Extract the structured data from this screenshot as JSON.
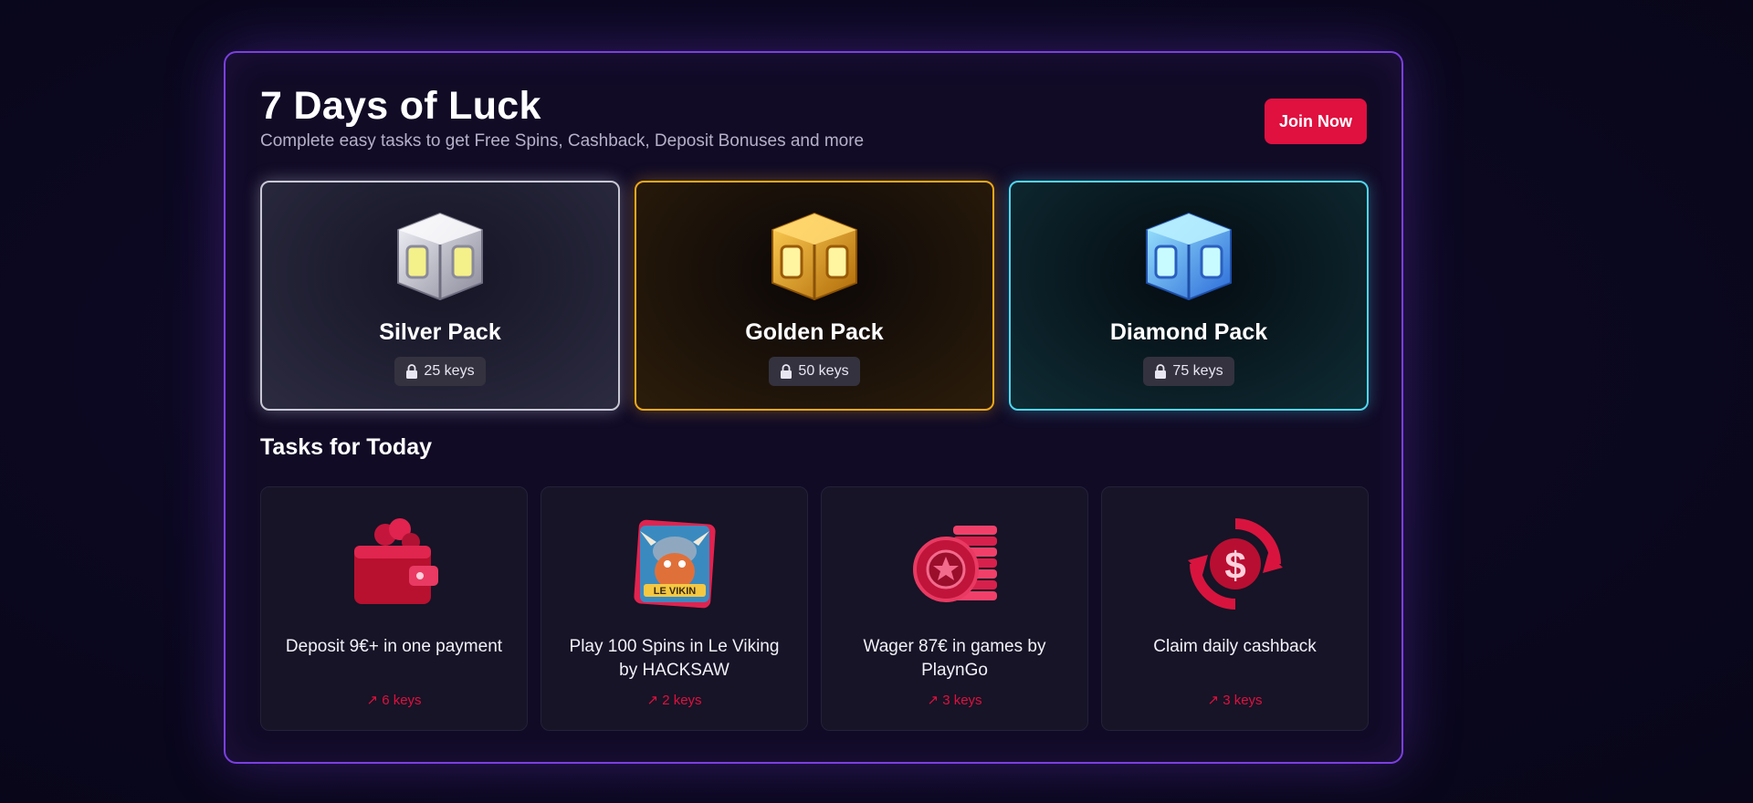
{
  "header": {
    "title": "7 Days of Luck",
    "subtitle": "Complete easy tasks to get Free Spins, Cashback, Deposit Bonuses and more",
    "join_label": "Join Now"
  },
  "colors": {
    "accent": "#e0103f",
    "panel_border": "#7b3fe0",
    "silver": "#c8c8d6",
    "gold": "#f0a818",
    "diamond": "#4fd6ee"
  },
  "packs": [
    {
      "name": "Silver Pack",
      "keys": "25 keys",
      "icon": "silver-cube-icon"
    },
    {
      "name": "Golden Pack",
      "keys": "50 keys",
      "icon": "gold-cube-icon"
    },
    {
      "name": "Diamond Pack",
      "keys": "75 keys",
      "icon": "diamond-cube-icon"
    }
  ],
  "tasks_title": "Tasks for Today",
  "tasks": [
    {
      "text": "Deposit 9€+ in one payment",
      "keys": "↗ 6 keys",
      "icon": "wallet-icon"
    },
    {
      "text": "Play 100 Spins in Le Viking by HACKSAW",
      "keys": "↗ 2 keys",
      "icon": "le-viking-game-icon"
    },
    {
      "text": "Wager 87€ in games by PlaynGo",
      "keys": "↗ 3 keys",
      "icon": "chip-stack-icon"
    },
    {
      "text": "Claim daily cashback",
      "keys": "↗ 3 keys",
      "icon": "cashback-icon"
    }
  ]
}
